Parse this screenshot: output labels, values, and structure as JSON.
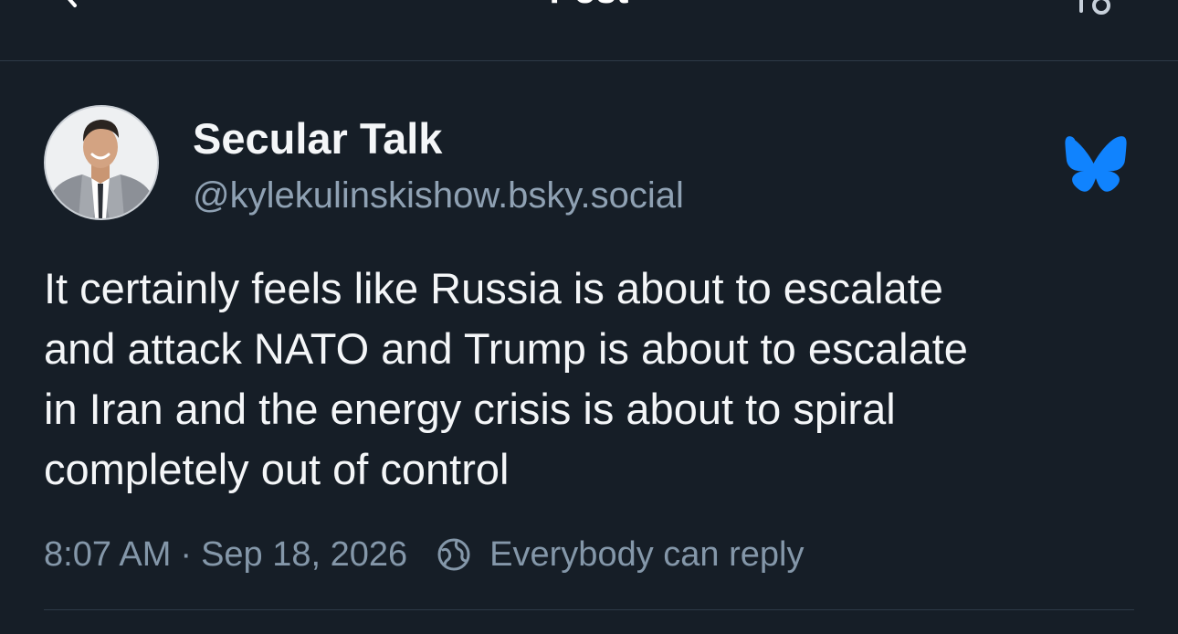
{
  "nav": {
    "title": "Post"
  },
  "post": {
    "author": {
      "display_name": "Secular Talk",
      "handle": "@kylekulinskishow.bsky.social"
    },
    "text": "It certainly feels like Russia is about to escalate\nand attack NATO and Trump is about to escalate\nin Iran and the energy crisis is about to spiral\ncompletely out of control",
    "time": "8:07 AM",
    "separator": "·",
    "date": "Sep 18, 2026",
    "reply_setting": "Everybody can reply"
  },
  "colors": {
    "background": "#161e27",
    "text_primary": "#f4f6f8",
    "text_secondary": "#8fa1b3",
    "brand_blue": "#1083fe",
    "divider": "#2e3a47"
  },
  "icons": {
    "back": "chevron-left-icon",
    "nav_right": "language-translate-icon",
    "brand": "bluesky-butterfly-icon",
    "reply_setting": "globe-icon"
  }
}
